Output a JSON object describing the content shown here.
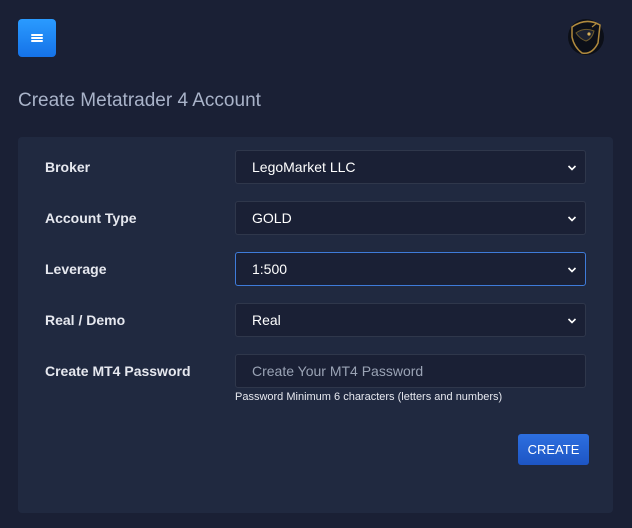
{
  "header": {
    "menu_icon": "hamburger-menu-icon",
    "logo_icon": "panther-logo-icon"
  },
  "page": {
    "title": "Create Metatrader 4 Account"
  },
  "form": {
    "broker": {
      "label": "Broker",
      "value": "LegoMarket LLC"
    },
    "account_type": {
      "label": "Account Type",
      "value": "GOLD"
    },
    "leverage": {
      "label": "Leverage",
      "value": "1:500"
    },
    "real_demo": {
      "label": "Real / Demo",
      "value": "Real"
    },
    "password": {
      "label": "Create MT4 Password",
      "placeholder": "Create Your MT4 Password",
      "help": "Password Minimum 6 characters (letters and numbers)"
    },
    "submit_label": "CREATE"
  },
  "colors": {
    "background": "#1a2035",
    "card": "#202940",
    "accent": "#1572e8",
    "button": "#1d55c4"
  }
}
